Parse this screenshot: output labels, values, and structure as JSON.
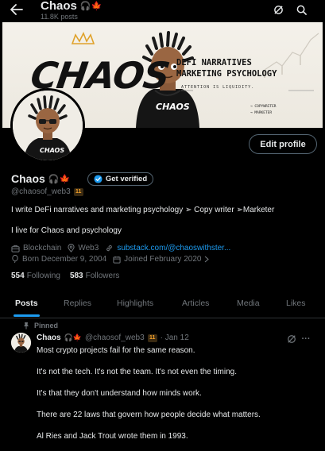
{
  "header": {
    "title": "Chaos",
    "title_emoji": "🎧🍁",
    "posts_count": "11.8K posts"
  },
  "banner": {
    "brand": "CHAOS",
    "headline_1": "DEFI NARRATIVES",
    "headline_2": "MARKETING PSYCHOLOGY",
    "tagline": "ATTENTION IS LIQUIDITY.",
    "role_1": "→ COPYWRITER",
    "role_2": "→ MARKETER",
    "hoodie_text": "CHAOS"
  },
  "profile": {
    "name": "Chaos",
    "name_emoji": "🎧🍁",
    "verify_label": "Get verified",
    "edit_label": "Edit profile",
    "handle": "@chaosof_web3",
    "badge": "11",
    "bio_line1": "I write DeFi narratives and marketing psychology ➢ Copy writer ➢Marketer",
    "bio_line2": "I live for Chaos and psychology",
    "category": "Blockchain",
    "location": "Web3",
    "link": "substack.com/@chaoswithster...",
    "born": "Born December 9, 2004",
    "joined": "Joined February 2020",
    "following_count": "554",
    "following_label": "Following",
    "followers_count": "583",
    "followers_label": "Followers"
  },
  "tabs": [
    "Posts",
    "Replies",
    "Highlights",
    "Articles",
    "Media",
    "Likes"
  ],
  "post": {
    "pinned_label": "Pinned",
    "author": "Chaos",
    "author_emoji": "🎧🍁",
    "handle": "@chaosof_web3",
    "badge": "11",
    "date": "· Jan 12",
    "more": "···",
    "lines": [
      "Most crypto projects fail for the same reason.",
      "It's not the tech. It's not the team. It's not even the timing.",
      "It's that they don't understand how minds work.",
      "There are 22 laws that govern how people decide what matters.",
      "Al Ries and Jack Trout wrote them in 1993."
    ]
  },
  "colors": {
    "accent": "#1d9bf0",
    "background": "#000000",
    "text_primary": "#e7e9ea",
    "text_secondary": "#71767b",
    "border": "#2f3336",
    "badge_orange": "#f7a229"
  }
}
